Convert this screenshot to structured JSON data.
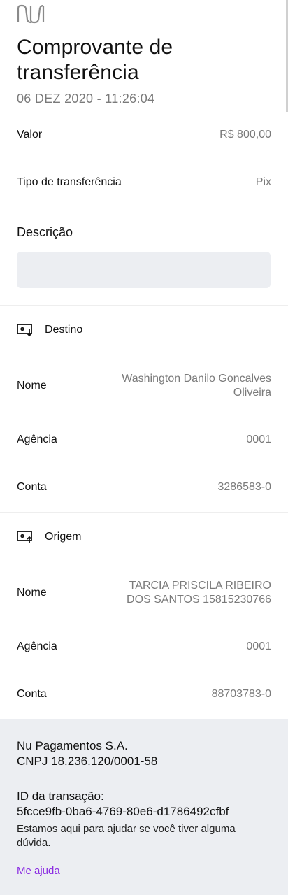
{
  "header": {
    "logo_icon": "nubank-logo-icon",
    "title": "Comprovante de transferência",
    "datetime": "06 DEZ 2020 - 11:26:04"
  },
  "summary": {
    "valor_label": "Valor",
    "valor_value": "R$ 800,00",
    "tipo_label": "Tipo de transferência",
    "tipo_value": "Pix",
    "descricao_label": "Descrição",
    "descricao_value": ""
  },
  "destino": {
    "icon": "receive-money-icon",
    "title": "Destino",
    "nome_label": "Nome",
    "nome_value": "Washington Danilo Goncalves Oliveira",
    "agencia_label": "Agência",
    "agencia_value": "0001",
    "conta_label": "Conta",
    "conta_value": "3286583-0"
  },
  "origem": {
    "icon": "send-money-icon",
    "title": "Origem",
    "nome_label": "Nome",
    "nome_value": "TARCIA PRISCILA RIBEIRO DOS SANTOS 15815230766",
    "agencia_label": "Agência",
    "agencia_value": "0001",
    "conta_label": "Conta",
    "conta_value": "88703783-0"
  },
  "footer": {
    "company": "Nu Pagamentos S.A.",
    "cnpj": "CNPJ 18.236.120/0001-58",
    "transaction_label": "ID da transação:",
    "transaction_id": "5fcce9fb-0ba6-4769-80e6-d1786492cfbf",
    "help_text": "Estamos aqui para ajudar se você tiver alguma dúvida.",
    "help_link": "Me ajuda",
    "link_color": "#8a2be2"
  }
}
